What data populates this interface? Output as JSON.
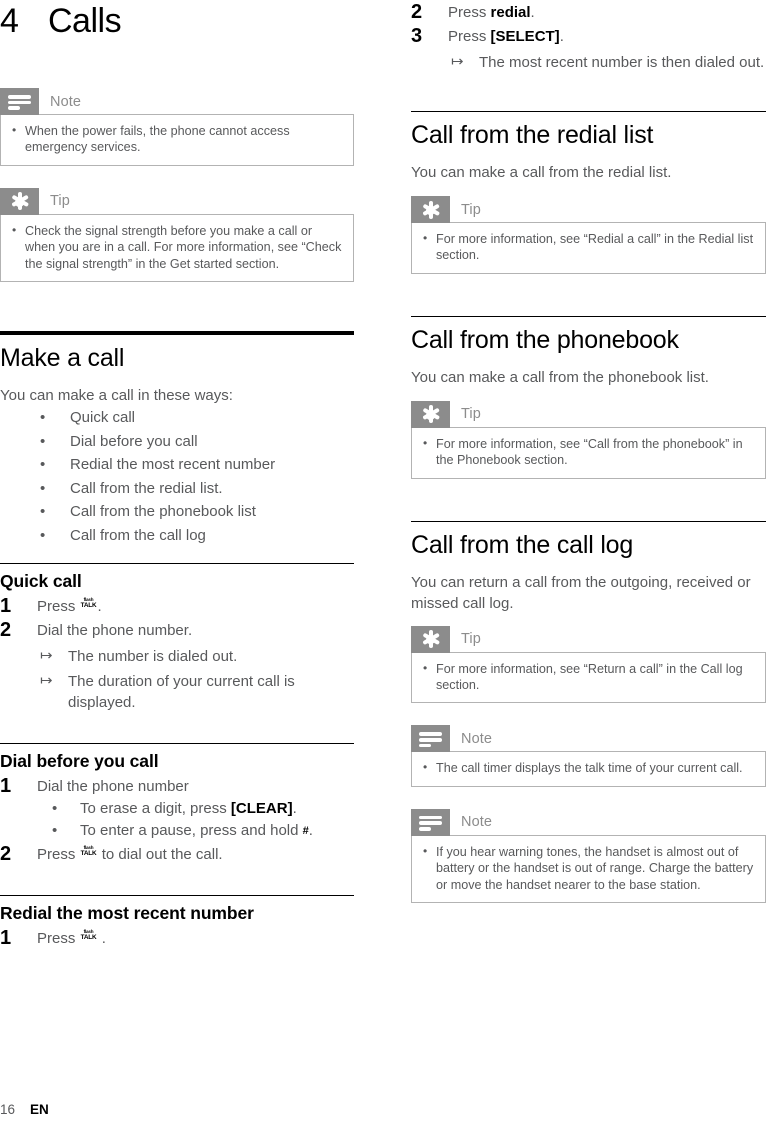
{
  "document": {
    "chapter_number": "4",
    "chapter_title": "Calls",
    "footer_page": "16",
    "footer_language": "EN",
    "colors": {
      "callout_header_gray": "#8c8c8c",
      "body_text": "#58595b",
      "heading_black": "#000000",
      "callout_border": "#b3b3b3"
    }
  },
  "left_column": {
    "note_1": {
      "icon": "note-icon",
      "label": "Note",
      "items": [
        "When the power fails, the phone cannot access emergency services."
      ]
    },
    "tip_1": {
      "icon": "tip-icon",
      "label": "Tip",
      "items": [
        "Check the signal strength before you make a call or when you are in a call. For more information, see “Check the signal strength” in the Get started section."
      ]
    },
    "make_a_call": {
      "heading": "Make a call",
      "intro": "You can make a call in these ways:",
      "ways": [
        "Quick call",
        "Dial before you call",
        "Redial the most recent number",
        "Call from the redial list.",
        "Call from the phonebook list",
        "Call from the call log"
      ]
    },
    "quick_call": {
      "heading": "Quick call",
      "step1_num": "1",
      "step1_pre": "Press",
      "step1_post": ".",
      "step1_key_top": "flash",
      "step1_key_bottom": "TALK",
      "step2_num": "2",
      "step2_text": "Dial the phone number.",
      "arrow_1": "The number is dialed out.",
      "arrow_2": "The duration of your current call is displayed."
    },
    "dial_before": {
      "heading": "Dial before you call",
      "step1_num": "1",
      "step1_text": "Dial the phone number",
      "sub1_pre": "To erase a digit, press ",
      "sub1_key": "[CLEAR]",
      "sub1_post": ".",
      "sub2_pre": "To enter a pause, press and hold ",
      "sub2_key": "#",
      "sub2_post": ".",
      "step2_num": "2",
      "step2_pre": "Press",
      "step2_post": "to dial out the call.",
      "step2_key_top": "flash",
      "step2_key_bottom": "TALK"
    },
    "redial_recent": {
      "heading": "Redial the most recent number",
      "step1_num": "1",
      "step1_pre": "Press",
      "step1_post": ".",
      "step1_key_top": "flash",
      "step1_key_bottom": "TALK"
    }
  },
  "right_column": {
    "redial_steps": {
      "step2_num": "2",
      "step2_pre": "Press ",
      "step2_key": "redial",
      "step2_post": ".",
      "step3_num": "3",
      "step3_pre": "Press ",
      "step3_key": "[SELECT]",
      "step3_post": ".",
      "arrow_1": "The most recent number is then dialed out."
    },
    "call_redial_list": {
      "heading": "Call from the redial list",
      "body": "You can make a call from the redial list.",
      "tip": {
        "icon": "tip-icon",
        "label": "Tip",
        "items": [
          "For more information, see “Redial a call” in the Redial list section."
        ]
      }
    },
    "call_phonebook": {
      "heading": "Call from the phonebook",
      "body": "You can make a call from the phonebook list.",
      "tip": {
        "icon": "tip-icon",
        "label": "Tip",
        "items": [
          "For more information, see “Call from the phonebook” in the Phonebook section."
        ]
      }
    },
    "call_log": {
      "heading": "Call from the call log",
      "body": "You can return a call from the outgoing, received or missed call log.",
      "tip": {
        "icon": "tip-icon",
        "label": "Tip",
        "items": [
          "For more information, see “Return a call” in the Call log section."
        ]
      },
      "note_1": {
        "icon": "note-icon",
        "label": "Note",
        "items": [
          "The call timer displays the talk time of your current call."
        ]
      },
      "note_2": {
        "icon": "note-icon",
        "label": "Note",
        "items": [
          "If you hear warning tones, the handset is almost out of battery or the handset is out of range. Charge the battery or move the handset nearer to the base station."
        ]
      }
    }
  }
}
